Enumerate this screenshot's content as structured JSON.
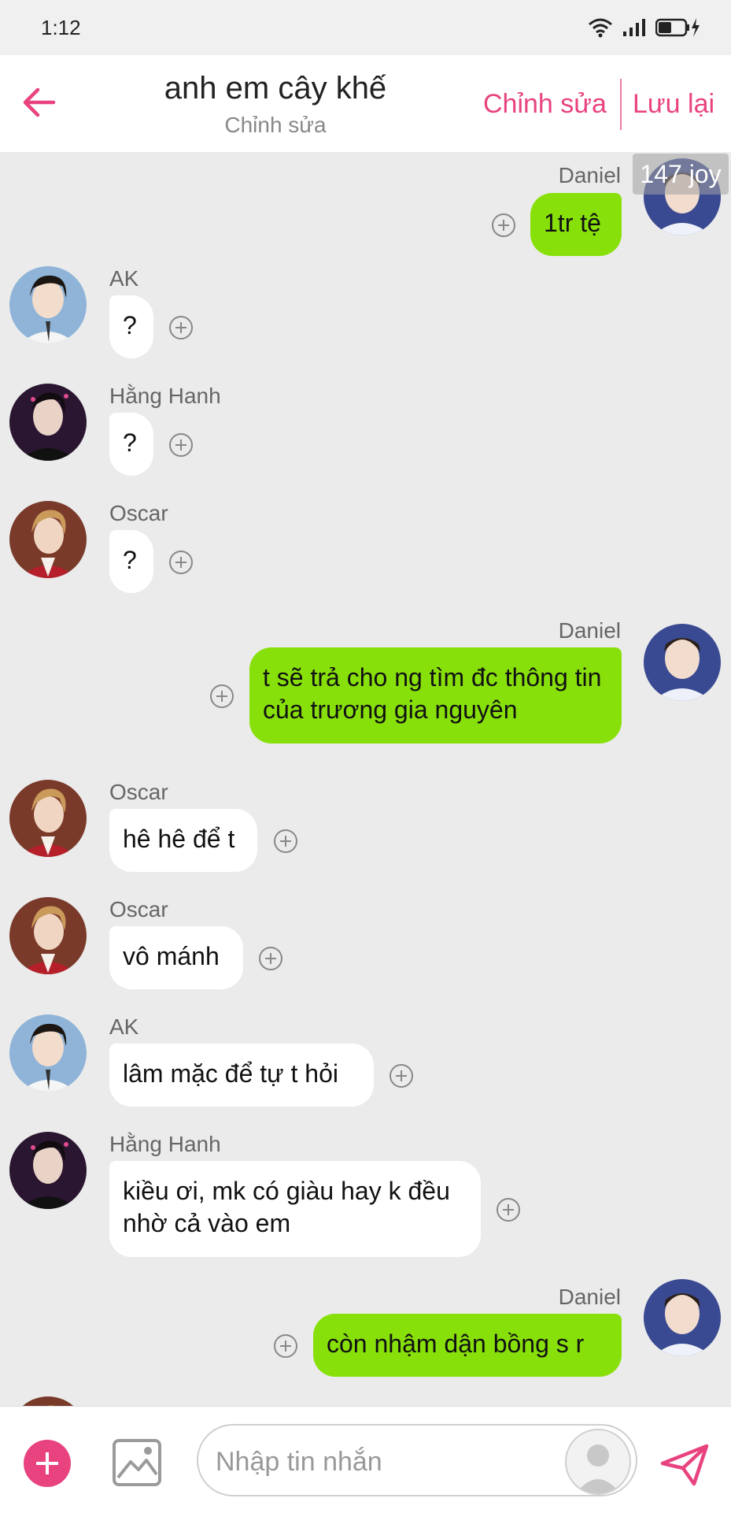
{
  "status_bar": {
    "time": "1:12"
  },
  "header": {
    "title": "anh em cây khế",
    "subtitle": "Chỉnh sửa",
    "edit_label": "Chỉnh sửa",
    "save_label": "Lưu lại"
  },
  "overlay_badge": "147 joy",
  "messages": [
    {
      "sender": "Daniel",
      "text": "1tr tệ",
      "direction": "out"
    },
    {
      "sender": "AK",
      "text": "?",
      "direction": "in"
    },
    {
      "sender": "Hằng Hanh",
      "text": "?",
      "direction": "in"
    },
    {
      "sender": "Oscar",
      "text": "?",
      "direction": "in"
    },
    {
      "sender": "Daniel",
      "text": "t sẽ trả cho ng tìm đc thông tin của trương gia nguyên",
      "direction": "out"
    },
    {
      "sender": "Oscar",
      "text": "hê hê để t",
      "direction": "in"
    },
    {
      "sender": "Oscar",
      "text": "vô mánh",
      "direction": "in"
    },
    {
      "sender": "AK",
      "text": "lâm mặc để tự t hỏi",
      "direction": "in"
    },
    {
      "sender": "Hằng Hanh",
      "text": "kiều ơi, mk có giàu hay k đều nhờ cả vào em",
      "direction": "in"
    },
    {
      "sender": "Daniel",
      "text": "còn nhậm dận bồng s r",
      "direction": "out"
    }
  ],
  "composer": {
    "placeholder": "Nhập tin nhắn"
  },
  "colors": {
    "accent": "#e8437f",
    "outgoing_bubble": "#88e00b",
    "incoming_bubble": "#ffffff",
    "background": "#ebebeb"
  }
}
